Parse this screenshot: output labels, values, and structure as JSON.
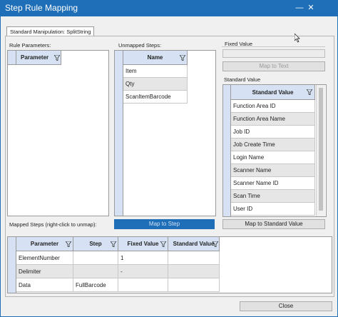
{
  "window": {
    "title": "Step Rule Mapping",
    "minimize": "—",
    "close": "✕"
  },
  "tab": {
    "label": "Standard Manipulation: SplitString"
  },
  "rule_parameters": {
    "label": "Rule Parameters:",
    "column": "Parameter"
  },
  "unmapped_steps": {
    "label": "Unmapped Steps:",
    "column": "Name",
    "rows": [
      "Item",
      "Qty",
      "ScanItemBarcode"
    ]
  },
  "fixed_value": {
    "label": "Fixed Value",
    "value": "",
    "button": "Map to Text"
  },
  "standard_value": {
    "label": "Standard Value",
    "column": "Standard Value",
    "rows": [
      "Function Area ID",
      "Function Area Name",
      "Job ID",
      "Job Create Time",
      "Login Name",
      "Scanner Name",
      "Scanner Name ID",
      "Scan Time",
      "User ID"
    ],
    "button": "Map to Standard Value"
  },
  "map_to_step_button": "Map to Step",
  "mapped_steps": {
    "label": "Mapped Steps (right-click to unmap):",
    "columns": [
      "Parameter",
      "Step",
      "Fixed Value",
      "Standard Value"
    ],
    "rows": [
      [
        "ElementNumber",
        "",
        "1",
        ""
      ],
      [
        "Delimiter",
        "",
        "-",
        ""
      ],
      [
        "Data",
        "FullBarcode",
        "",
        ""
      ]
    ]
  },
  "close_button": "Close",
  "colors": {
    "accent": "#1f6fb8",
    "header": "#d6e2f3"
  }
}
